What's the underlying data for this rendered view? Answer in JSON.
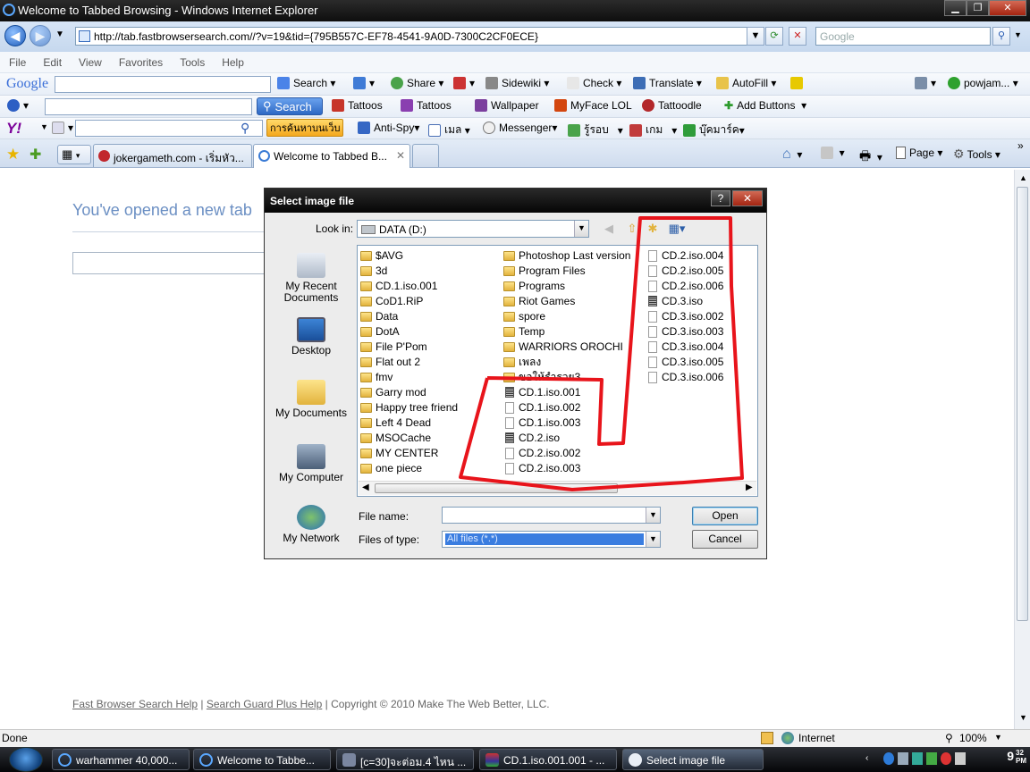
{
  "window": {
    "title": "Welcome to Tabbed Browsing - Windows Internet Explorer",
    "controls": {
      "minimize": "▁",
      "maximize": "❐",
      "close": "✕"
    }
  },
  "address_bar": {
    "url": "http://tab.fastbrowsersearch.com//?v=19&tid={795B557C-EF78-4541-9A0D-7300C2CF0ECE}",
    "search_placeholder": "Google"
  },
  "menu": [
    "File",
    "Edit",
    "View",
    "Favorites",
    "Tools",
    "Help"
  ],
  "google_toolbar": {
    "logo": "Google",
    "items": [
      "Search",
      "Share",
      "Sidewiki",
      "Check",
      "Translate",
      "AutoFill"
    ],
    "user": "powjam..."
  },
  "fbs_toolbar": {
    "search_button": "Search",
    "items": [
      "Tattoos",
      "Tattoos",
      "Wallpaper",
      "MyFace LOL",
      "Tattoodle",
      "Add Buttons"
    ]
  },
  "yahoo_toolbar": {
    "logo": "Y!",
    "search_label": "การค้นหาบนเว็บ",
    "items": [
      "Anti-Spy",
      "เมล",
      "Messenger",
      "รู้รอบ",
      "เกม",
      "บุ๊คมาร์ค"
    ]
  },
  "tabs": [
    {
      "label": "jokergameth.com - เริ่มหัว..."
    },
    {
      "label": "Welcome to Tabbed B..."
    }
  ],
  "command_bar": {
    "page": "Page",
    "tools": "Tools"
  },
  "page": {
    "heading": "You've opened a new tab",
    "footer": {
      "link1": "Fast Browser Search Help",
      "link2": "Search Guard Plus Help",
      "copyright": "| Copyright © 2010 Make The Web Better, LLC.",
      "sep": "|"
    }
  },
  "status_bar": {
    "status": "Done",
    "zone": "Internet",
    "zoom": "100%"
  },
  "taskbar": {
    "tasks": [
      {
        "label": "warhammer 40,000..."
      },
      {
        "label": "Welcome to Tabbe..."
      },
      {
        "label": "[c=30]จะต่อม.4 ไหน ..."
      },
      {
        "label": "CD.1.iso.001.001 - ..."
      },
      {
        "label": "Select image file"
      }
    ],
    "clock": "9",
    "clock_small": "32\nPM"
  },
  "dialog": {
    "title": "Select image file",
    "help": "?",
    "close": "✕",
    "look_in_label": "Look in:",
    "look_in_value": "DATA (D:)",
    "places": [
      {
        "label": "My Recent Documents"
      },
      {
        "label": "Desktop"
      },
      {
        "label": "My Documents"
      },
      {
        "label": "My Computer"
      },
      {
        "label": "My Network"
      }
    ],
    "columns": [
      [
        {
          "name": "$AVG",
          "type": "folder"
        },
        {
          "name": "3d",
          "type": "folder"
        },
        {
          "name": "CD.1.iso.001",
          "type": "folder"
        },
        {
          "name": "CoD1.RiP",
          "type": "folder"
        },
        {
          "name": "Data",
          "type": "folder"
        },
        {
          "name": "DotA",
          "type": "folder"
        },
        {
          "name": "File P'Pom",
          "type": "folder"
        },
        {
          "name": "Flat out 2",
          "type": "folder"
        },
        {
          "name": "fmv",
          "type": "folder"
        },
        {
          "name": "Garry mod",
          "type": "folder"
        },
        {
          "name": "Happy tree friend",
          "type": "folder"
        },
        {
          "name": "Left 4 Dead",
          "type": "folder"
        },
        {
          "name": "MSOCache",
          "type": "folder"
        },
        {
          "name": "MY CENTER",
          "type": "folder"
        },
        {
          "name": "one piece",
          "type": "folder"
        }
      ],
      [
        {
          "name": "Photoshop Last version",
          "type": "folder"
        },
        {
          "name": "Program Files",
          "type": "folder"
        },
        {
          "name": "Programs",
          "type": "folder"
        },
        {
          "name": "Riot Games",
          "type": "folder"
        },
        {
          "name": "spore",
          "type": "folder"
        },
        {
          "name": "Temp",
          "type": "folder"
        },
        {
          "name": "WARRIORS OROCHI",
          "type": "folder"
        },
        {
          "name": "เพลง",
          "type": "folder"
        },
        {
          "name": "ขอให้รำรวย3",
          "type": "folder"
        },
        {
          "name": "CD.1.iso.001",
          "type": "disc"
        },
        {
          "name": "CD.1.iso.002",
          "type": "file"
        },
        {
          "name": "CD.1.iso.003",
          "type": "file"
        },
        {
          "name": "CD.2.iso",
          "type": "disc"
        },
        {
          "name": "CD.2.iso.002",
          "type": "file"
        },
        {
          "name": "CD.2.iso.003",
          "type": "file"
        }
      ],
      [
        {
          "name": "CD.2.iso.004",
          "type": "file"
        },
        {
          "name": "CD.2.iso.005",
          "type": "file"
        },
        {
          "name": "CD.2.iso.006",
          "type": "file"
        },
        {
          "name": "CD.3.iso",
          "type": "disc"
        },
        {
          "name": "CD.3.iso.002",
          "type": "file"
        },
        {
          "name": "CD.3.iso.003",
          "type": "file"
        },
        {
          "name": "CD.3.iso.004",
          "type": "file"
        },
        {
          "name": "CD.3.iso.005",
          "type": "file"
        },
        {
          "name": "CD.3.iso.006",
          "type": "file"
        }
      ]
    ],
    "file_name_label": "File name:",
    "file_name_value": "",
    "file_type_label": "Files of type:",
    "file_type_value": "All files (*.*)",
    "open_button": "Open",
    "cancel_button": "Cancel"
  },
  "annotation_color": "#e8141b"
}
